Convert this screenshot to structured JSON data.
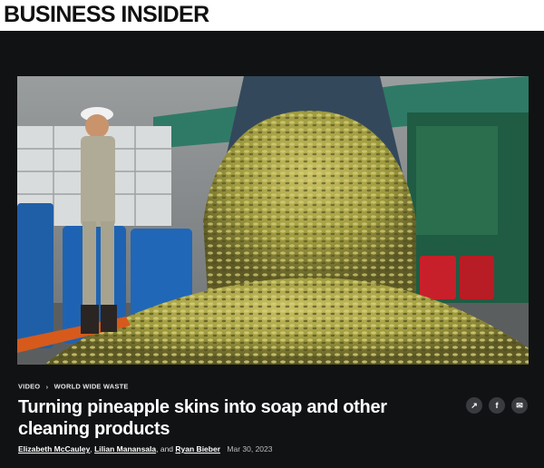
{
  "site": {
    "logo": "BUSINESS INSIDER"
  },
  "breadcrumb": {
    "items": [
      "VIDEO",
      "WORLD WIDE WASTE"
    ],
    "separator": "›"
  },
  "article": {
    "headline": "Turning pineapple skins into soap and other cleaning products",
    "authors": [
      "Elizabeth McCauley",
      "Lilian Manansala",
      "Ryan Bieber"
    ],
    "author_joiners": [
      ", ",
      ", and "
    ],
    "date": "Mar 30, 2023"
  },
  "share": {
    "share_icon": "share-icon",
    "facebook_icon": "facebook-icon",
    "email_icon": "email-icon",
    "facebook_glyph": "f",
    "share_glyph": "↗",
    "email_glyph": "✉"
  },
  "colors": {
    "background": "#111214",
    "header_bg": "#ffffff",
    "button_bg": "#3a3b3e"
  }
}
